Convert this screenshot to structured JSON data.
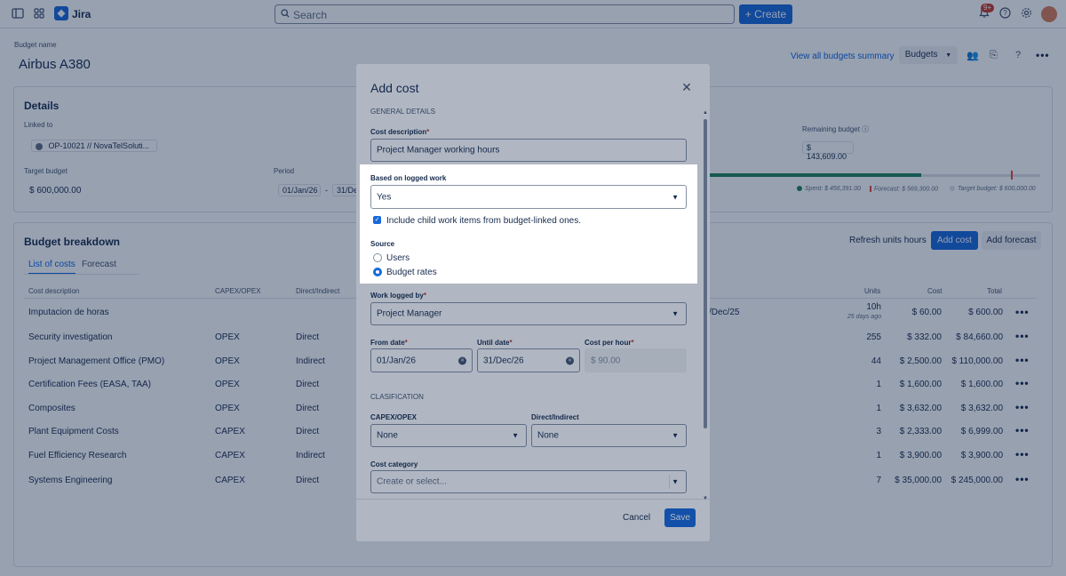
{
  "app": {
    "name": "Jira"
  },
  "topnav": {
    "search_placeholder": "Search",
    "create_label": "Create",
    "notifications_badge": "9+"
  },
  "page": {
    "budget_name_label": "Budget name",
    "budget_name": "Airbus A380",
    "view_all_link": "View all budgets summary",
    "budgets_button": "Budgets"
  },
  "details": {
    "heading": "Details",
    "linked_to_label": "Linked to",
    "linked_to_value": "OP-10021 // NovaTelSoluti...",
    "target_budget_label": "Target budget",
    "target_budget_value": "$ 600,000.00",
    "period_label": "Period",
    "period_start": "01/Jan/26",
    "period_sep": "-",
    "period_end": "31/De",
    "remaining_label": "Remaining budget",
    "remaining_value": "$ 143,609.00",
    "legend_spent": "Spent: $ 456,391.00",
    "legend_forecast": "Forecast: $ 569,300.00",
    "legend_target": "Target budget: $ 600,000.00",
    "colors": {
      "spent": "#1f845a",
      "forecast": "#e2483d",
      "target": "#dcdfe4"
    }
  },
  "breakdown": {
    "heading": "Budget breakdown",
    "tabs": [
      "List of costs",
      "Forecast"
    ],
    "refresh_button": "Refresh units hours",
    "add_cost_button": "Add cost",
    "add_forecast_button": "Add forecast",
    "columns": {
      "description": "Cost description",
      "capex": "CAPEX/OPEX",
      "direct": "Direct/Indirect",
      "units": "Units",
      "cost": "Cost",
      "total": "Total"
    },
    "rows": [
      {
        "description": "Imputacion de horas",
        "capex": "",
        "direct": "",
        "units": "10h",
        "units_sub": "25 days ago",
        "cost": "$ 60.00",
        "total": "$ 600.00",
        "date": "/Dec/25"
      },
      {
        "description": "Security investigation",
        "capex": "OPEX",
        "direct": "Direct",
        "units": "255",
        "units_sub": "",
        "cost": "$ 332.00",
        "total": "$ 84,660.00",
        "date": ""
      },
      {
        "description": "Project Management Office (PMO)",
        "capex": "OPEX",
        "direct": "Indirect",
        "units": "44",
        "units_sub": "",
        "cost": "$ 2,500.00",
        "total": "$ 110,000.00",
        "date": ""
      },
      {
        "description": "Certification Fees (EASA, TAA)",
        "capex": "OPEX",
        "direct": "Direct",
        "units": "1",
        "units_sub": "",
        "cost": "$ 1,600.00",
        "total": "$ 1,600.00",
        "date": ""
      },
      {
        "description": "Composites",
        "capex": "OPEX",
        "direct": "Direct",
        "units": "1",
        "units_sub": "",
        "cost": "$ 3,632.00",
        "total": "$ 3,632.00",
        "date": ""
      },
      {
        "description": "Plant Equipment Costs",
        "capex": "CAPEX",
        "direct": "Direct",
        "units": "3",
        "units_sub": "",
        "cost": "$ 2,333.00",
        "total": "$ 6,999.00",
        "date": ""
      },
      {
        "description": "Fuel Efficiency Research",
        "capex": "CAPEX",
        "direct": "Indirect",
        "units": "1",
        "units_sub": "",
        "cost": "$ 3,900.00",
        "total": "$ 3,900.00",
        "date": ""
      },
      {
        "description": "Systems Engineering",
        "capex": "CAPEX",
        "direct": "Direct",
        "units": "7",
        "units_sub": "",
        "cost": "$ 35,000.00",
        "total": "$ 245,000.00",
        "date": ""
      }
    ]
  },
  "modal": {
    "title": "Add cost",
    "general_details": "General details",
    "cost_description_label": "Cost description",
    "cost_description_value": "Project Manager working hours",
    "based_on_logged_label": "Based on logged work",
    "based_on_logged_value": "Yes",
    "include_child_label": "Include child work items from budget-linked ones.",
    "include_child_checked": true,
    "source_label": "Source",
    "source_options": [
      "Users",
      "Budget rates"
    ],
    "source_selected": "Budget rates",
    "work_logged_by_label": "Work logged by",
    "work_logged_by_value": "Project Manager",
    "from_date_label": "From date",
    "from_date_value": "01/Jan/26",
    "until_date_label": "Until date",
    "until_date_value": "31/Dec/26",
    "cost_per_hour_label": "Cost per hour",
    "cost_per_hour_value": "$ 90.00",
    "clasification": "Clasification",
    "capex_label": "CAPEX/OPEX",
    "capex_value": "None",
    "direct_label": "Direct/Indirect",
    "direct_value": "None",
    "cost_category_label": "Cost category",
    "cost_category_placeholder": "Create or select...",
    "cancel_label": "Cancel",
    "save_label": "Save",
    "required_mark": "*"
  },
  "icons": {
    "sidebar": "sidebar-toggle-icon",
    "apps": "app-switcher-icon",
    "search": "search-icon",
    "plus": "plus-icon",
    "bell": "bell-icon",
    "help": "help-icon",
    "settings": "gear-icon",
    "close": "close-icon",
    "chevron": "chevron-down-icon"
  }
}
